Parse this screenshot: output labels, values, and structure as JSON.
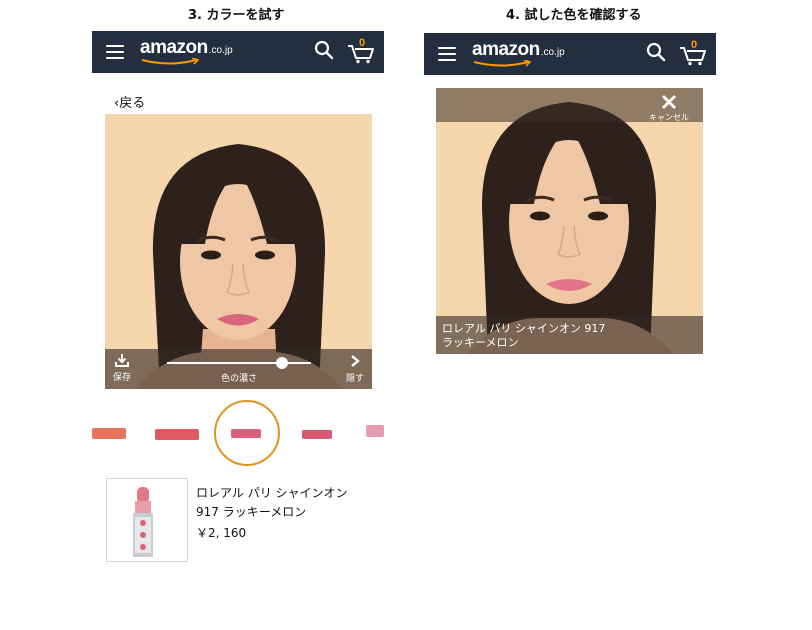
{
  "step3": {
    "title": "3. カラーを試す",
    "header": {
      "logo_text": "amazon",
      "logo_tld": ".co.jp",
      "cart_count": "0"
    },
    "back_label": "‹戻る",
    "controls": {
      "save_label": "保存",
      "slider_label": "色の濃さ",
      "hide_label": "隠す",
      "intensity": 0.8
    },
    "swatches": [
      {
        "color": "#e8735e"
      },
      {
        "color": "#e05a62"
      },
      {
        "color": "#d9607a"
      },
      {
        "color": "#d55a72"
      },
      {
        "color": "#e69bb0"
      }
    ],
    "selected_swatch": 2,
    "product": {
      "name": "ロレアル パリ シャインオン 917 ラッキーメロン",
      "price": "￥2, 160"
    }
  },
  "step4": {
    "title": "4. 試した色を確認する",
    "header": {
      "logo_text": "amazon",
      "logo_tld": ".co.jp",
      "cart_count": "0"
    },
    "cancel_label": "キャンセル",
    "caption_line1": "ロレアル パリ シャインオン 917",
    "caption_line2": "ラッキーメロン"
  }
}
